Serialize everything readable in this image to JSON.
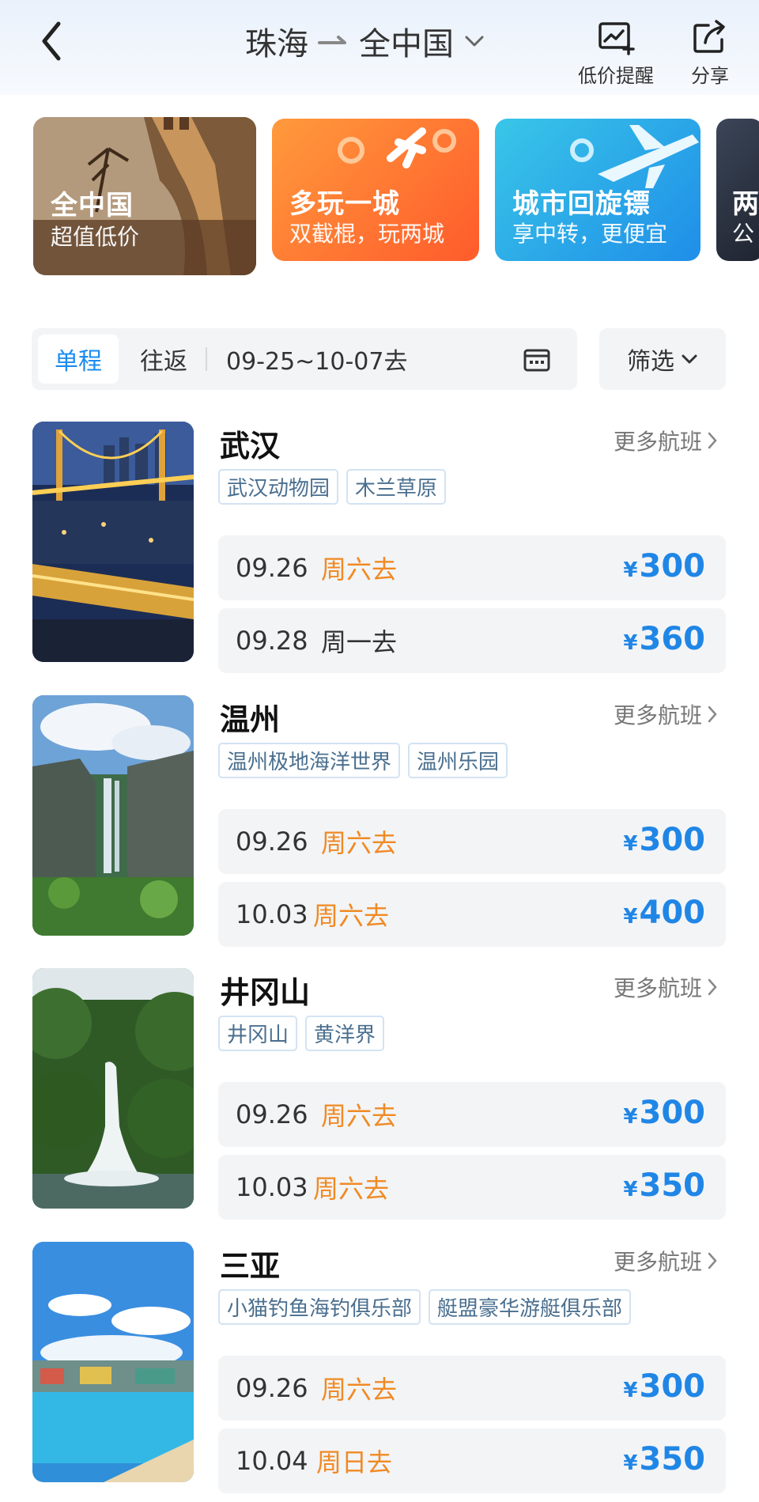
{
  "header": {
    "origin": "珠海",
    "destination": "全中国",
    "price_alert_label": "低价提醒",
    "share_label": "分享"
  },
  "banners": [
    {
      "title": "全中国",
      "subtitle": "超值低价"
    },
    {
      "title": "多玩一城",
      "subtitle": "双截棍，玩两城"
    },
    {
      "title": "城市回旋镖",
      "subtitle": "享中转，更便宜"
    },
    {
      "title": "两",
      "subtitle": "公"
    }
  ],
  "filter": {
    "oneway_label": "单程",
    "roundtrip_label": "往返",
    "date_range": "09-25~10-07去",
    "filter_label": "筛选"
  },
  "more_flights_label": "更多航班",
  "destinations": [
    {
      "name": "武汉",
      "tags": [
        "武汉动物园",
        "木兰草原"
      ],
      "flights": [
        {
          "date": "09.26",
          "day": "周六去",
          "price": "300",
          "highlight": true
        },
        {
          "date": "09.28",
          "day": "周一去",
          "price": "360",
          "highlight": false
        }
      ]
    },
    {
      "name": "温州",
      "tags": [
        "温州极地海洋世界",
        "温州乐园"
      ],
      "flights": [
        {
          "date": "09.26",
          "day": "周六去",
          "price": "300",
          "highlight": true
        },
        {
          "date": "10.03",
          "day": "周六去",
          "price": "400",
          "highlight": true
        }
      ]
    },
    {
      "name": "井冈山",
      "tags": [
        "井冈山",
        "黄洋界"
      ],
      "flights": [
        {
          "date": "09.26",
          "day": "周六去",
          "price": "300",
          "highlight": true
        },
        {
          "date": "10.03",
          "day": "周六去",
          "price": "350",
          "highlight": true
        }
      ]
    },
    {
      "name": "三亚",
      "tags": [
        "小猫钓鱼海钓俱乐部",
        "艇盟豪华游艇俱乐部"
      ],
      "flights": [
        {
          "date": "09.26",
          "day": "周六去",
          "price": "300",
          "highlight": true
        },
        {
          "date": "10.04",
          "day": "周日去",
          "price": "350",
          "highlight": true
        }
      ]
    }
  ],
  "currency_symbol": "¥",
  "colors": {
    "accent_blue": "#1a8cf0",
    "price_blue": "#2086e6",
    "weekend_orange": "#f08a24"
  }
}
